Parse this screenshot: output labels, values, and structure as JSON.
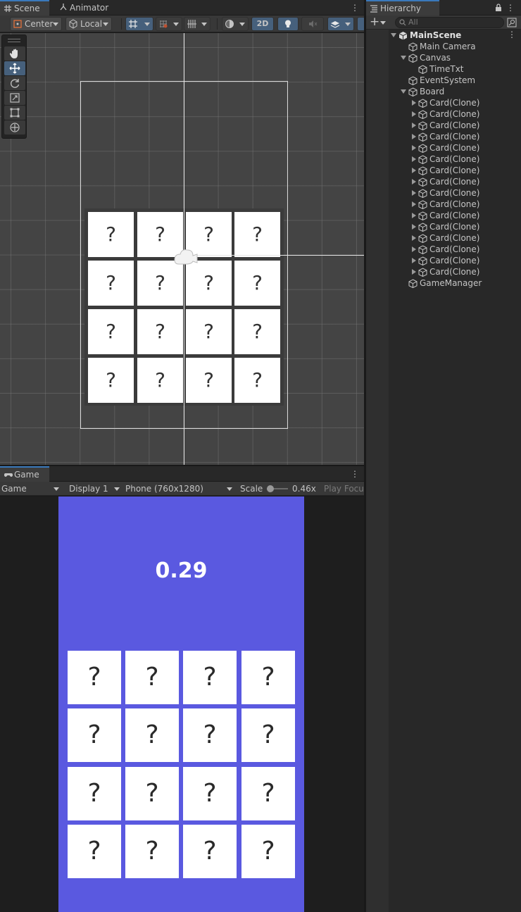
{
  "tabs": {
    "scene": "Scene",
    "animator": "Animator",
    "game": "Game",
    "hierarchy": "Hierarchy"
  },
  "scene_toolbar": {
    "pivot": "Center",
    "space": "Local",
    "mode_2d": "2D"
  },
  "scene_cards": [
    "?",
    "?",
    "?",
    "?",
    "?",
    "?",
    "?",
    "?",
    "?",
    "?",
    "?",
    "?",
    "?",
    "?",
    "?",
    "?"
  ],
  "game_toolbar": {
    "view": "Game",
    "display": "Display 1",
    "resolution": "Phone (760x1280)",
    "scale_label": "Scale",
    "scale_value": "0.46x",
    "play_focus": "Play Focu"
  },
  "game": {
    "timer": "0.29",
    "cards": [
      "?",
      "?",
      "?",
      "?",
      "?",
      "?",
      "?",
      "?",
      "?",
      "?",
      "?",
      "?",
      "?",
      "?",
      "?",
      "?"
    ],
    "background_color": "#5a59e0"
  },
  "hierarchy": {
    "search_placeholder": "All",
    "items": [
      {
        "label": "MainScene",
        "depth": 0,
        "fold": "open",
        "bold": true
      },
      {
        "label": "Main Camera",
        "depth": 1,
        "fold": "none"
      },
      {
        "label": "Canvas",
        "depth": 1,
        "fold": "open"
      },
      {
        "label": "TimeTxt",
        "depth": 2,
        "fold": "none"
      },
      {
        "label": "EventSystem",
        "depth": 1,
        "fold": "none"
      },
      {
        "label": "Board",
        "depth": 1,
        "fold": "open"
      },
      {
        "label": "Card(Clone)",
        "depth": 2,
        "fold": "closed"
      },
      {
        "label": "Card(Clone)",
        "depth": 2,
        "fold": "closed"
      },
      {
        "label": "Card(Clone)",
        "depth": 2,
        "fold": "closed"
      },
      {
        "label": "Card(Clone)",
        "depth": 2,
        "fold": "closed"
      },
      {
        "label": "Card(Clone)",
        "depth": 2,
        "fold": "closed"
      },
      {
        "label": "Card(Clone)",
        "depth": 2,
        "fold": "closed"
      },
      {
        "label": "Card(Clone)",
        "depth": 2,
        "fold": "closed"
      },
      {
        "label": "Card(Clone)",
        "depth": 2,
        "fold": "closed"
      },
      {
        "label": "Card(Clone)",
        "depth": 2,
        "fold": "closed"
      },
      {
        "label": "Card(Clone)",
        "depth": 2,
        "fold": "closed"
      },
      {
        "label": "Card(Clone)",
        "depth": 2,
        "fold": "closed"
      },
      {
        "label": "Card(Clone)",
        "depth": 2,
        "fold": "closed"
      },
      {
        "label": "Card(Clone)",
        "depth": 2,
        "fold": "closed"
      },
      {
        "label": "Card(Clone)",
        "depth": 2,
        "fold": "closed"
      },
      {
        "label": "Card(Clone)",
        "depth": 2,
        "fold": "closed"
      },
      {
        "label": "Card(Clone)",
        "depth": 2,
        "fold": "closed"
      },
      {
        "label": "GameManager",
        "depth": 1,
        "fold": "none"
      }
    ]
  },
  "colors": {
    "accent": "#3a79bb",
    "active_button": "#46607c"
  }
}
